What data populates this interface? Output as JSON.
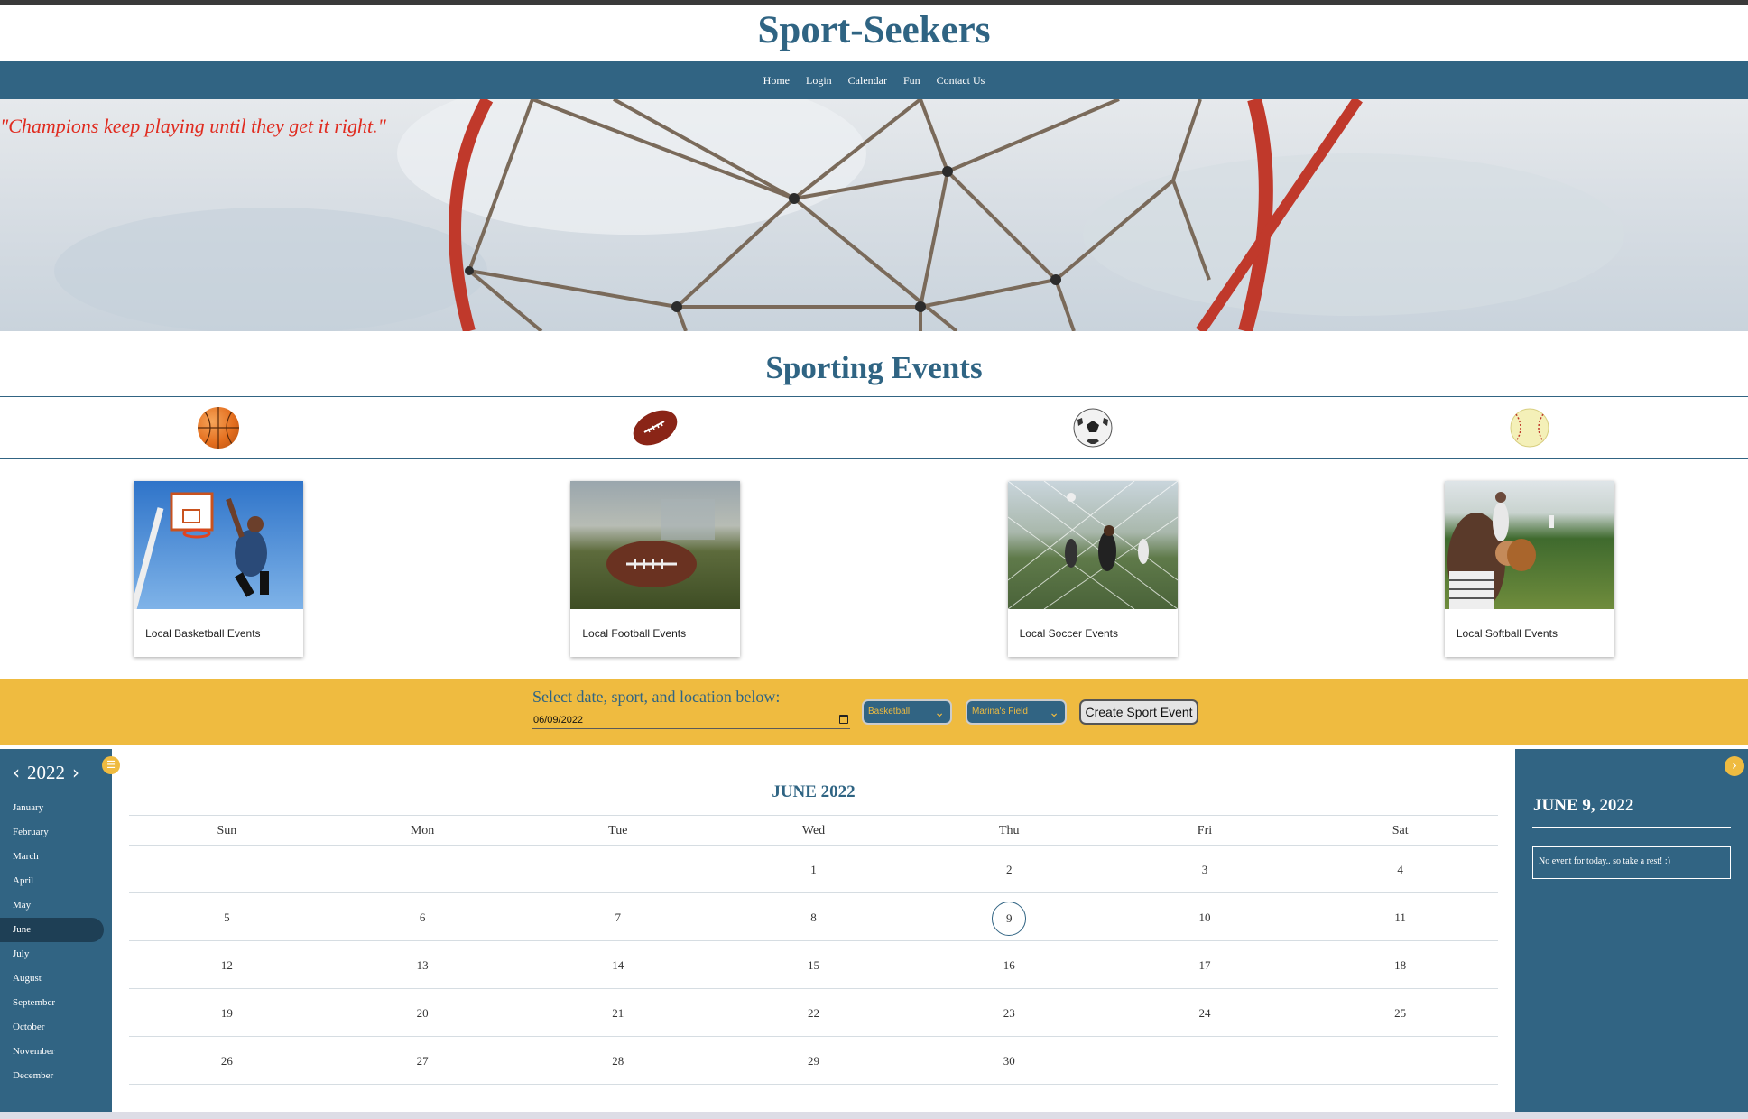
{
  "header": {
    "title": "Sport-Seekers"
  },
  "nav": {
    "items": [
      "Home",
      "Login",
      "Calendar",
      "Fun",
      "Contact Us"
    ]
  },
  "hero": {
    "quote": "\"Champions keep playing until they get it right.\""
  },
  "events": {
    "title": "Sporting Events",
    "sports": [
      {
        "icon": "basketball-icon",
        "label": "Local Basketball Events"
      },
      {
        "icon": "football-icon",
        "label": "Local Football Events"
      },
      {
        "icon": "soccer-ball-icon",
        "label": "Local Soccer Events"
      },
      {
        "icon": "softball-icon",
        "label": "Local Softball Events"
      }
    ]
  },
  "form": {
    "prompt": "Select date, sport, and location below:",
    "date_value": "06/09/2022",
    "sport_value": "Basketball",
    "location_value": "Marina's Field",
    "create_label": "Create Sport Event"
  },
  "calendar": {
    "year": "2022",
    "months": [
      "January",
      "February",
      "March",
      "April",
      "May",
      "June",
      "July",
      "August",
      "September",
      "October",
      "November",
      "December"
    ],
    "active_month": "June",
    "month_title": "JUNE 2022",
    "weekdays": [
      "Sun",
      "Mon",
      "Tue",
      "Wed",
      "Thu",
      "Fri",
      "Sat"
    ],
    "weeks": [
      [
        "",
        "",
        "",
        "1",
        "2",
        "3",
        "4"
      ],
      [
        "5",
        "6",
        "7",
        "8",
        "9",
        "10",
        "11"
      ],
      [
        "12",
        "13",
        "14",
        "15",
        "16",
        "17",
        "18"
      ],
      [
        "19",
        "20",
        "21",
        "22",
        "23",
        "24",
        "25"
      ],
      [
        "26",
        "27",
        "28",
        "29",
        "30",
        "",
        ""
      ]
    ],
    "selected_day": "9"
  },
  "side_panel": {
    "date": "JUNE 9, 2022",
    "message": "No event for today.. so take a rest! :)"
  },
  "colors": {
    "primary": "#316483",
    "accent": "#efbb40",
    "quote": "#e02b1f"
  }
}
